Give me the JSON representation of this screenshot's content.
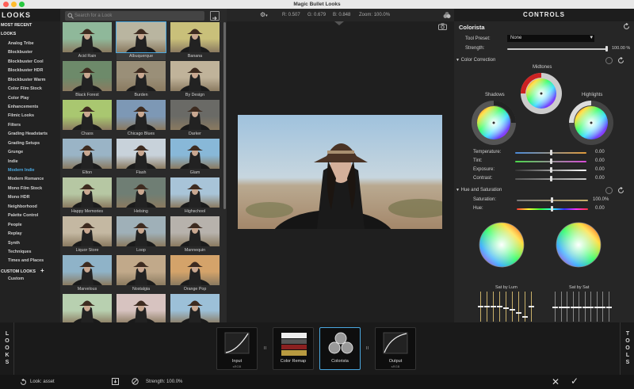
{
  "window": {
    "title": "Magic Bullet Looks"
  },
  "left_panel": {
    "header": "LOOKS",
    "categories": [
      {
        "label": "MOST RECENT",
        "type": "section"
      },
      {
        "label": "LOOKS",
        "type": "section"
      },
      {
        "label": "Analog Tribe"
      },
      {
        "label": "Blockbuster"
      },
      {
        "label": "Blockbuster Cool"
      },
      {
        "label": "Blockbuster HDR"
      },
      {
        "label": "Blockbuster Warm"
      },
      {
        "label": "Color Film Stock"
      },
      {
        "label": "Color Play"
      },
      {
        "label": "Enhancements"
      },
      {
        "label": "Filmic Looks"
      },
      {
        "label": "Filters"
      },
      {
        "label": "Grading Headstarts"
      },
      {
        "label": "Grading Setups"
      },
      {
        "label": "Grunge"
      },
      {
        "label": "Indie"
      },
      {
        "label": "Modern Indie",
        "active": true
      },
      {
        "label": "Modern Romance"
      },
      {
        "label": "Mono Film Stock"
      },
      {
        "label": "Mono HDR"
      },
      {
        "label": "Neighborhood"
      },
      {
        "label": "Palette Control"
      },
      {
        "label": "People"
      },
      {
        "label": "Replay"
      },
      {
        "label": "Synth"
      },
      {
        "label": "Techniques"
      },
      {
        "label": "Times and Places"
      },
      {
        "label": "CUSTOM LOOKS",
        "type": "section",
        "plus": "+"
      },
      {
        "label": "Custom"
      }
    ]
  },
  "search": {
    "placeholder": "Search for a Look"
  },
  "thumbnails": [
    {
      "label": "Acid Rain",
      "tint": "#8fb89a"
    },
    {
      "label": "Albuquerque",
      "tint": "#b9b5a0",
      "selected": true
    },
    {
      "label": "Banana",
      "tint": "#c9c07a"
    },
    {
      "label": "Black Forest",
      "tint": "#6d8a6a"
    },
    {
      "label": "Burden",
      "tint": "#9a8f78"
    },
    {
      "label": "By Design",
      "tint": "#c0b39a"
    },
    {
      "label": "Chaos",
      "tint": "#a9c770"
    },
    {
      "label": "Chicago Blues",
      "tint": "#7d98b5"
    },
    {
      "label": "Darker",
      "tint": "#6a6a66"
    },
    {
      "label": "Elton",
      "tint": "#9ab4c6"
    },
    {
      "label": "Flash",
      "tint": "#c8d2da"
    },
    {
      "label": "Glam",
      "tint": "#88b8d8"
    },
    {
      "label": "Happy Memories",
      "tint": "#b6c7a3"
    },
    {
      "label": "Helsing",
      "tint": "#6f7e74"
    },
    {
      "label": "Highschool",
      "tint": "#a8c4d8"
    },
    {
      "label": "Liquor Store",
      "tint": "#c4b8a2"
    },
    {
      "label": "Loop",
      "tint": "#9fb0b8"
    },
    {
      "label": "Mannequin",
      "tint": "#b7b2ac"
    },
    {
      "label": "Marvelous",
      "tint": "#8fb3c8"
    },
    {
      "label": "Nostalgia",
      "tint": "#c1a98a"
    },
    {
      "label": "Orange Pop",
      "tint": "#d4a36a"
    },
    {
      "label": "",
      "tint": "#b8d0b0"
    },
    {
      "label": "",
      "tint": "#d7c3c0"
    },
    {
      "label": "",
      "tint": "#9cc0d8"
    }
  ],
  "viewer": {
    "r_label": "R:",
    "r": "0.507",
    "g_label": "G:",
    "g": "0.679",
    "b_label": "B:",
    "b": "0.848",
    "zoom_label": "Zoom:",
    "zoom": "100.0%"
  },
  "controls": {
    "header": "CONTROLS",
    "tool_name": "Colorista",
    "tool_preset_label": "Tool Preset:",
    "tool_preset_value": "None",
    "strength_label": "Strength:",
    "strength_value": "100.00 %",
    "strength_level": 1.0,
    "color_correction": "Color Correction",
    "midtones": "Midtones",
    "shadows": "Shadows",
    "highlights": "Highlights",
    "sliders": [
      {
        "label": "Temperature:",
        "value": "0.00",
        "level": 0.5
      },
      {
        "label": "Tint:",
        "value": "0.00",
        "level": 0.5
      },
      {
        "label": "Exposure:",
        "value": "0.00",
        "level": 0.5
      },
      {
        "label": "Contrast:",
        "value": "0.00",
        "level": 0.5
      }
    ],
    "hue_sat": "Hue and Saturation",
    "saturation_label": "Saturation:",
    "saturation_value": "100.0%",
    "hue_label": "Hue:",
    "hue_value": "0.00",
    "sat_by_lum": "Sat by Lum",
    "sat_by_sat": "Sat by Sat"
  },
  "pipeline": {
    "left_label": "LOOKS",
    "right_label": "TOOLS",
    "tools": [
      {
        "label": "Input",
        "sub": "sRGB"
      },
      {
        "label": "Color Remap",
        "sub": ""
      },
      {
        "label": "Colorista",
        "sub": "",
        "selected": true
      },
      {
        "label": "Output",
        "sub": "sRGB"
      }
    ]
  },
  "status": {
    "look_label": "Look:",
    "look_value": "asset",
    "strength_label": "Strength:",
    "strength_value": "100.0%"
  }
}
